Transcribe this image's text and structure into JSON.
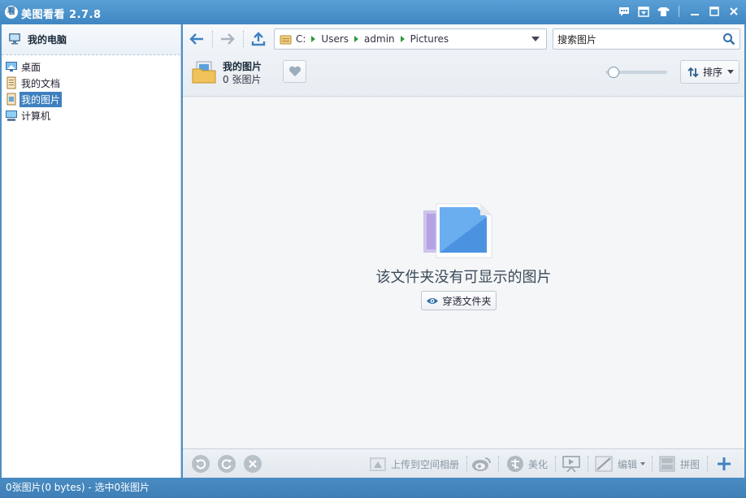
{
  "app": {
    "title": "美图看看 2.7.8",
    "logo_glyph": "看"
  },
  "titlebar": {
    "icons": [
      "message-icon",
      "skin-window-icon",
      "tshirt-icon",
      "minimize-icon",
      "maximize-icon",
      "close-icon"
    ]
  },
  "sidebar": {
    "header": "我的电脑",
    "items": [
      {
        "label": "桌面",
        "icon": "desktop-icon",
        "selected": false
      },
      {
        "label": "我的文档",
        "icon": "documents-icon",
        "selected": false
      },
      {
        "label": "我的图片",
        "icon": "pictures-icon",
        "selected": true
      },
      {
        "label": "计算机",
        "icon": "computer-icon",
        "selected": false
      }
    ]
  },
  "address": {
    "crumbs": [
      "C:",
      "Users",
      "admin",
      "Pictures"
    ]
  },
  "search": {
    "value": "搜索图片"
  },
  "folder": {
    "name": "我的图片",
    "count": "0 张图片"
  },
  "sort": {
    "label": "排序"
  },
  "empty": {
    "message": "该文件夹没有可显示的图片",
    "pierce_label": "穿透文件夹"
  },
  "bottombar": {
    "upload_label": "上传到空间相册",
    "beautify_label": "美化",
    "edit_label": "编辑",
    "collage_label": "拼图"
  },
  "status": {
    "text": "0张图片(0 bytes) - 选中0张图片"
  },
  "colors": {
    "accent": "#3e80bf",
    "titlebar": "#4a8fc6",
    "path_arrow": "#2c9a3c"
  }
}
